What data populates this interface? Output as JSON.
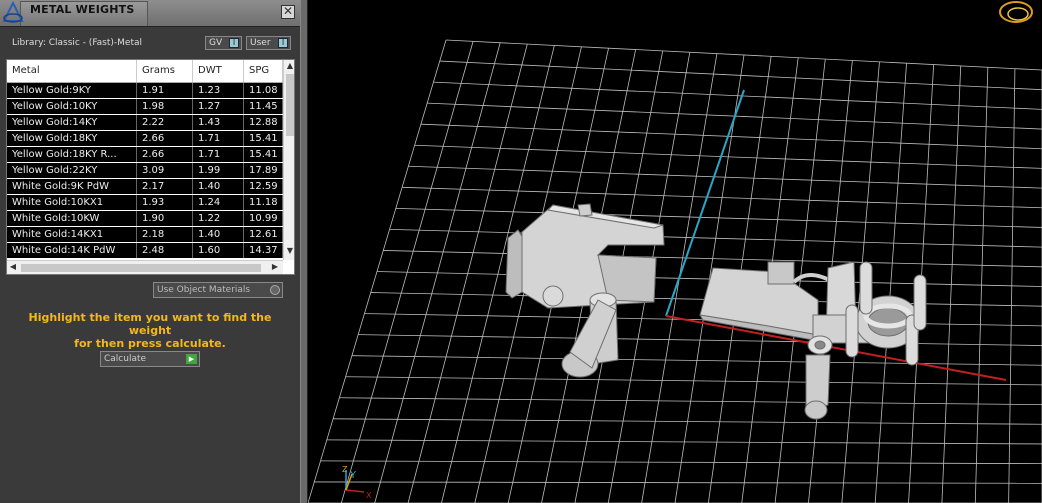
{
  "panel": {
    "title": "METAL WEIGHTS",
    "close_label": "✕",
    "library_label": "Library: Classic - (Fast)-Metal",
    "toggles": [
      {
        "label": "GV",
        "key": "I"
      },
      {
        "label": "User",
        "key": "I"
      }
    ],
    "table": {
      "headers": [
        "Metal",
        "Grams",
        "DWT",
        "SPG"
      ],
      "rows": [
        [
          "Yellow Gold:9KY",
          "1.91",
          "1.23",
          "11.08"
        ],
        [
          "Yellow Gold:10KY",
          "1.98",
          "1.27",
          "11.45"
        ],
        [
          "Yellow Gold:14KY",
          "2.22",
          "1.43",
          "12.88"
        ],
        [
          "Yellow Gold:18KY",
          "2.66",
          "1.71",
          "15.41"
        ],
        [
          "Yellow Gold:18KY R...",
          "2.66",
          "1.71",
          "15.41"
        ],
        [
          "Yellow Gold:22KY",
          "3.09",
          "1.99",
          "17.89"
        ],
        [
          "White Gold:9K PdW",
          "2.17",
          "1.40",
          "12.59"
        ],
        [
          "White Gold:10KX1",
          "1.93",
          "1.24",
          "11.18"
        ],
        [
          "White Gold:10KW",
          "1.90",
          "1.22",
          "10.99"
        ],
        [
          "White Gold:14KX1",
          "2.18",
          "1.40",
          "12.61"
        ],
        [
          "White Gold:14K PdW",
          "2.48",
          "1.60",
          "14.37"
        ]
      ]
    },
    "use_object_materials_label": "Use Object Materials",
    "hint_line1": "Highlight the item you want to find the weight",
    "hint_line2": "for then press calculate.",
    "calculate_label": "Calculate"
  },
  "viewport": {
    "axis_y_label": "Y",
    "axis_z_label": "Z",
    "axis_x_label": "X",
    "colors": {
      "grid": "#bdbdbd",
      "x_axis": "#c02020",
      "y_axis": "#2aa6c8",
      "model": "#d4d4d4",
      "hint_text": "#f3b81b"
    }
  }
}
